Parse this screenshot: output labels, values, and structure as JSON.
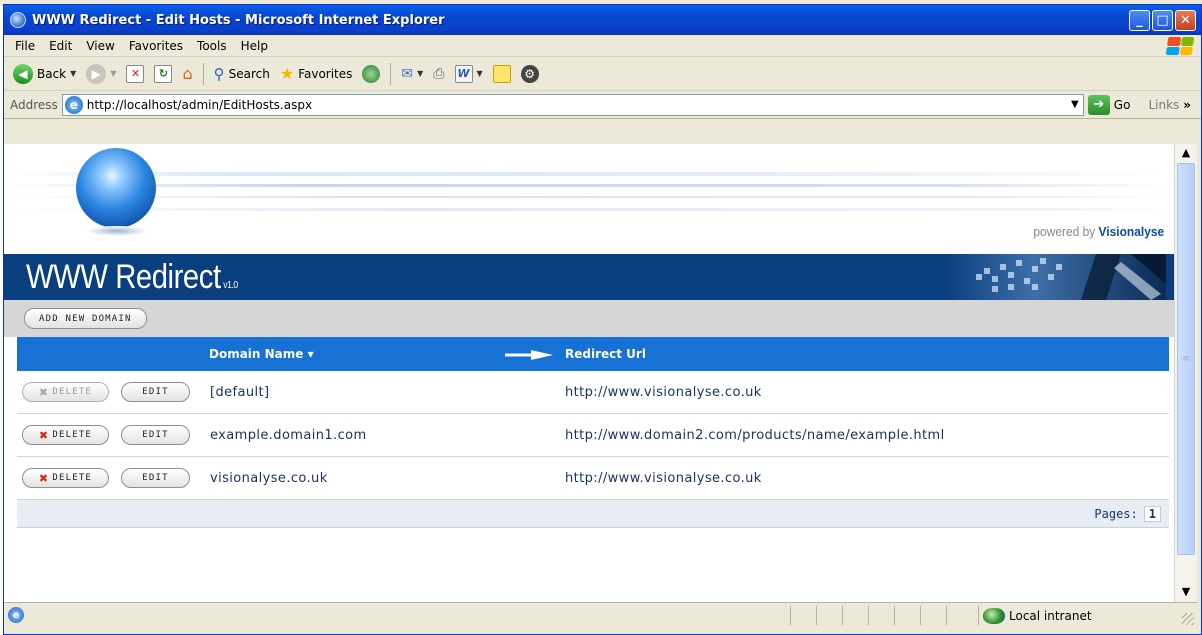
{
  "window": {
    "title": "WWW Redirect - Edit Hosts - Microsoft Internet Explorer",
    "controls": [
      "minimize",
      "maximize",
      "close"
    ]
  },
  "menu": [
    "File",
    "Edit",
    "View",
    "Favorites",
    "Tools",
    "Help"
  ],
  "toolbar": {
    "back_label": "Back",
    "search_label": "Search",
    "favorites_label": "Favorites"
  },
  "address": {
    "label": "Address",
    "url": "http://localhost/admin/EditHosts.aspx",
    "go_label": "Go",
    "links_label": "Links"
  },
  "site": {
    "powered_prefix": "powered by",
    "powered_brand": "Visionalyse",
    "app_title": "WWW Redirect",
    "version": "v1.0",
    "add_domain_label": "ADD NEW DOMAIN"
  },
  "grid": {
    "columns": {
      "domain": "Domain Name",
      "redirect": "Redirect Url"
    },
    "delete_label": "DELETE",
    "edit_label": "EDIT",
    "rows": [
      {
        "domain": "[default]",
        "redirect": "http://www.visionalyse.co.uk",
        "delete_enabled": false
      },
      {
        "domain": "example.domain1.com",
        "redirect": "http://www.domain2.com/products/name/example.html",
        "delete_enabled": true
      },
      {
        "domain": "visionalyse.co.uk",
        "redirect": "http://www.visionalyse.co.uk",
        "delete_enabled": true
      }
    ],
    "pager_label": "Pages:",
    "current_page": "1"
  },
  "status": {
    "zone": "Local intranet"
  },
  "colors": {
    "titlebar": "#0846d2",
    "brand_bar": "#0a3f7f",
    "grid_header": "#1872d6",
    "link_text": "#1a3466"
  }
}
